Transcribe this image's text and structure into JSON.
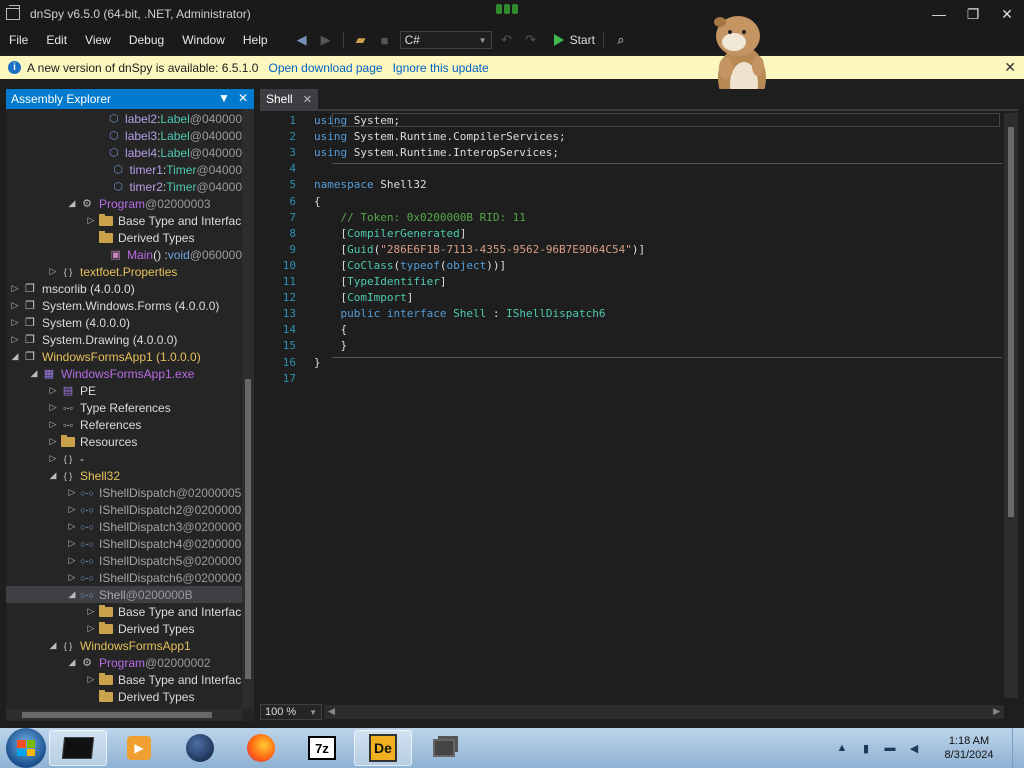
{
  "window": {
    "title": "dnSpy v6.5.0 (64-bit, .NET, Administrator)",
    "controls": {
      "minimize": "—",
      "restore": "❐",
      "close": "✕"
    }
  },
  "menu": [
    "File",
    "Edit",
    "View",
    "Debug",
    "Window",
    "Help"
  ],
  "toolbar": {
    "language": "C#",
    "start_label": "Start"
  },
  "infobar": {
    "message": "A new version of dnSpy is available: 6.5.1.0",
    "link_download": "Open download page",
    "link_ignore": "Ignore this update"
  },
  "explorer": {
    "title": "Assembly Explorer",
    "rows": [
      {
        "indent": 5,
        "twisty": "",
        "icon": "field-icon",
        "parts": [
          [
            "label2",
            "c-field"
          ],
          [
            " : ",
            "c-white"
          ],
          [
            "Label",
            "c-type"
          ],
          [
            " @040000",
            "c-gray"
          ]
        ]
      },
      {
        "indent": 5,
        "twisty": "",
        "icon": "field-icon",
        "parts": [
          [
            "label3",
            "c-field"
          ],
          [
            " : ",
            "c-white"
          ],
          [
            "Label",
            "c-type"
          ],
          [
            " @040000",
            "c-gray"
          ]
        ]
      },
      {
        "indent": 5,
        "twisty": "",
        "icon": "field-icon",
        "parts": [
          [
            "label4",
            "c-field"
          ],
          [
            " : ",
            "c-white"
          ],
          [
            "Label",
            "c-type"
          ],
          [
            " @040000",
            "c-gray"
          ]
        ]
      },
      {
        "indent": 5,
        "twisty": "",
        "icon": "field-icon",
        "parts": [
          [
            "timer1",
            "c-field"
          ],
          [
            " : ",
            "c-white"
          ],
          [
            "Timer",
            "c-type"
          ],
          [
            " @04000",
            "c-gray"
          ]
        ]
      },
      {
        "indent": 5,
        "twisty": "",
        "icon": "field-icon",
        "parts": [
          [
            "timer2",
            "c-field"
          ],
          [
            " : ",
            "c-white"
          ],
          [
            "Timer",
            "c-type"
          ],
          [
            " @04000",
            "c-gray"
          ]
        ]
      },
      {
        "indent": 3,
        "twisty": "◢",
        "icon": "class-icon",
        "parts": [
          [
            "Program",
            "c-purple"
          ],
          [
            " @02000003",
            "c-gray"
          ]
        ]
      },
      {
        "indent": 4,
        "twisty": "▷",
        "icon": "folder-icon",
        "parts": [
          [
            "Base Type and Interfac",
            "c-white"
          ]
        ]
      },
      {
        "indent": 4,
        "twisty": "",
        "icon": "folder-icon",
        "parts": [
          [
            "Derived Types",
            "c-white"
          ]
        ]
      },
      {
        "indent": 5,
        "twisty": "",
        "icon": "method-icon",
        "parts": [
          [
            "Main",
            "c-purple"
          ],
          [
            "() : ",
            "c-white"
          ],
          [
            "void",
            "c-blue"
          ],
          [
            " @060000",
            "c-gray"
          ]
        ]
      },
      {
        "indent": 2,
        "twisty": "▷",
        "icon": "namespace-icon",
        "parts": [
          [
            "textfoet.Properties",
            "c-yellow"
          ]
        ]
      },
      {
        "indent": 0,
        "twisty": "▷",
        "icon": "assembly-icon",
        "parts": [
          [
            "mscorlib (4.0.0.0)",
            "c-white"
          ]
        ]
      },
      {
        "indent": 0,
        "twisty": "▷",
        "icon": "assembly-icon",
        "parts": [
          [
            "System.Windows.Forms (4.0.0.0)",
            "c-white"
          ]
        ]
      },
      {
        "indent": 0,
        "twisty": "▷",
        "icon": "assembly-icon",
        "parts": [
          [
            "System (4.0.0.0)",
            "c-white"
          ]
        ]
      },
      {
        "indent": 0,
        "twisty": "▷",
        "icon": "assembly-icon",
        "parts": [
          [
            "System.Drawing (4.0.0.0)",
            "c-white"
          ]
        ]
      },
      {
        "indent": 0,
        "twisty": "◢",
        "icon": "assembly-icon",
        "parts": [
          [
            "WindowsFormsApp1 (1.0.0.0)",
            "c-yellow"
          ]
        ]
      },
      {
        "indent": 1,
        "twisty": "◢",
        "icon": "module-icon",
        "parts": [
          [
            "WindowsFormsApp1.exe",
            "c-purple"
          ]
        ]
      },
      {
        "indent": 2,
        "twisty": "▷",
        "icon": "pe-icon",
        "parts": [
          [
            "PE",
            "c-white"
          ]
        ]
      },
      {
        "indent": 2,
        "twisty": "▷",
        "icon": "typeref-icon",
        "parts": [
          [
            "Type References",
            "c-white"
          ]
        ]
      },
      {
        "indent": 2,
        "twisty": "▷",
        "icon": "reference-icon",
        "parts": [
          [
            "References",
            "c-white"
          ]
        ]
      },
      {
        "indent": 2,
        "twisty": "▷",
        "icon": "folder-icon",
        "parts": [
          [
            "Resources",
            "c-white"
          ]
        ]
      },
      {
        "indent": 2,
        "twisty": "▷",
        "icon": "namespace-icon",
        "parts": [
          [
            "-",
            "c-white"
          ]
        ]
      },
      {
        "indent": 2,
        "twisty": "◢",
        "icon": "namespace-icon",
        "parts": [
          [
            "Shell32",
            "c-yellow"
          ]
        ]
      },
      {
        "indent": 3,
        "twisty": "▷",
        "icon": "interface-icon",
        "parts": [
          [
            "IShellDispatch",
            "c-iface"
          ],
          [
            " @02000005",
            "c-gray"
          ]
        ]
      },
      {
        "indent": 3,
        "twisty": "▷",
        "icon": "interface-icon",
        "parts": [
          [
            "IShellDispatch2",
            "c-iface"
          ],
          [
            " @0200000",
            "c-gray"
          ]
        ]
      },
      {
        "indent": 3,
        "twisty": "▷",
        "icon": "interface-icon",
        "parts": [
          [
            "IShellDispatch3",
            "c-iface"
          ],
          [
            " @0200000",
            "c-gray"
          ]
        ]
      },
      {
        "indent": 3,
        "twisty": "▷",
        "icon": "interface-icon",
        "parts": [
          [
            "IShellDispatch4",
            "c-iface"
          ],
          [
            " @0200000",
            "c-gray"
          ]
        ]
      },
      {
        "indent": 3,
        "twisty": "▷",
        "icon": "interface-icon",
        "parts": [
          [
            "IShellDispatch5",
            "c-iface"
          ],
          [
            " @0200000",
            "c-gray"
          ]
        ]
      },
      {
        "indent": 3,
        "twisty": "▷",
        "icon": "interface-icon",
        "parts": [
          [
            "IShellDispatch6",
            "c-iface"
          ],
          [
            " @0200000",
            "c-gray"
          ]
        ]
      },
      {
        "indent": 3,
        "twisty": "◢",
        "icon": "interface-icon",
        "selected": true,
        "parts": [
          [
            "Shell",
            "c-iface"
          ],
          [
            " @0200000B",
            "c-gray"
          ]
        ]
      },
      {
        "indent": 4,
        "twisty": "▷",
        "icon": "folder-icon",
        "parts": [
          [
            "Base Type and Interfac",
            "c-white"
          ]
        ]
      },
      {
        "indent": 4,
        "twisty": "▷",
        "icon": "folder-icon",
        "parts": [
          [
            "Derived Types",
            "c-white"
          ]
        ]
      },
      {
        "indent": 2,
        "twisty": "◢",
        "icon": "namespace-icon",
        "parts": [
          [
            "WindowsFormsApp1",
            "c-yellow"
          ]
        ]
      },
      {
        "indent": 3,
        "twisty": "◢",
        "icon": "class-icon",
        "parts": [
          [
            "Program",
            "c-purple"
          ],
          [
            " @02000002",
            "c-gray"
          ]
        ]
      },
      {
        "indent": 4,
        "twisty": "▷",
        "icon": "folder-icon",
        "parts": [
          [
            "Base Type and Interfac",
            "c-white"
          ]
        ]
      },
      {
        "indent": 4,
        "twisty": "",
        "icon": "folder-icon",
        "parts": [
          [
            "Derived Types",
            "c-white"
          ]
        ]
      }
    ]
  },
  "editor": {
    "tab": "Shell",
    "zoom": "100 %",
    "lines": [
      [
        [
          "using",
          "kw"
        ],
        [
          " System;",
          "txt"
        ]
      ],
      [
        [
          "using",
          "kw"
        ],
        [
          " System.Runtime.CompilerServices;",
          "txt"
        ]
      ],
      [
        [
          "using",
          "kw"
        ],
        [
          " System.Runtime.InteropServices;",
          "txt"
        ]
      ],
      [],
      [
        [
          "namespace",
          "kw"
        ],
        [
          " Shell32",
          "txt"
        ]
      ],
      [
        [
          "{",
          "txt"
        ]
      ],
      [
        [
          "    ",
          "txt"
        ],
        [
          "// Token: 0x0200000B RID: 11",
          "cm"
        ]
      ],
      [
        [
          "    [",
          "txt"
        ],
        [
          "CompilerGenerated",
          "ty"
        ],
        [
          "]",
          "txt"
        ]
      ],
      [
        [
          "    [",
          "txt"
        ],
        [
          "Guid",
          "ty"
        ],
        [
          "(",
          "txt"
        ],
        [
          "\"286E6F1B-7113-4355-9562-96B7E9D64C54\"",
          "str"
        ],
        [
          ")]",
          "txt"
        ]
      ],
      [
        [
          "    [",
          "txt"
        ],
        [
          "CoClass",
          "ty"
        ],
        [
          "(",
          "txt"
        ],
        [
          "typeof",
          "kw"
        ],
        [
          "(",
          "txt"
        ],
        [
          "object",
          "kw"
        ],
        [
          "))]",
          "txt"
        ]
      ],
      [
        [
          "    [",
          "txt"
        ],
        [
          "TypeIdentifier",
          "ty"
        ],
        [
          "]",
          "txt"
        ]
      ],
      [
        [
          "    [",
          "txt"
        ],
        [
          "ComImport",
          "ty"
        ],
        [
          "]",
          "txt"
        ]
      ],
      [
        [
          "    ",
          "txt"
        ],
        [
          "public",
          "kw"
        ],
        [
          " ",
          "txt"
        ],
        [
          "interface",
          "kw"
        ],
        [
          " ",
          "txt"
        ],
        [
          "Shell",
          "ty"
        ],
        [
          " : ",
          "txt"
        ],
        [
          "IShellDispatch6",
          "ty"
        ]
      ],
      [
        [
          "    {",
          "txt"
        ]
      ],
      [
        [
          "    }",
          "txt"
        ]
      ],
      [
        [
          "}",
          "txt"
        ]
      ],
      []
    ]
  },
  "taskbar": {
    "time": "1:18 AM",
    "date": "8/31/2024",
    "apps": [
      "terminal-icon",
      "media-player-icon",
      "globe-icon",
      "firefox-icon",
      "7zip-icon",
      "dnspy-icon",
      "window-switcher-icon"
    ]
  },
  "colors": {
    "accent": "#007acc",
    "infobar_bg": "#fbf7bf",
    "editor_bg": "#1e1e1e",
    "keyword": "#569cd6",
    "type": "#4ec9b0",
    "string": "#d69d85",
    "comment": "#57a64a"
  }
}
